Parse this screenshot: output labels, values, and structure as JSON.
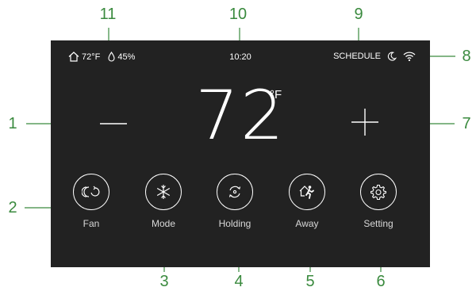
{
  "status": {
    "indoor_temp": "72°F",
    "humidity": "45%",
    "time": "10:20",
    "schedule_label": "SCHEDULE"
  },
  "setpoint": {
    "value": "72",
    "unit": "°F"
  },
  "buttons": [
    {
      "label": "Fan",
      "icon": "fan-icon"
    },
    {
      "label": "Mode",
      "icon": "snowflake-icon"
    },
    {
      "label": "Holding",
      "icon": "holding-icon"
    },
    {
      "label": "Away",
      "icon": "away-icon"
    },
    {
      "label": "Setting",
      "icon": "gear-icon"
    }
  ],
  "callouts": [
    "1",
    "2",
    "3",
    "4",
    "5",
    "6",
    "7",
    "8",
    "9",
    "10",
    "11"
  ],
  "colors": {
    "screen": "#222222",
    "callout": "#3a8a3e",
    "foreground": "#ffffff"
  }
}
